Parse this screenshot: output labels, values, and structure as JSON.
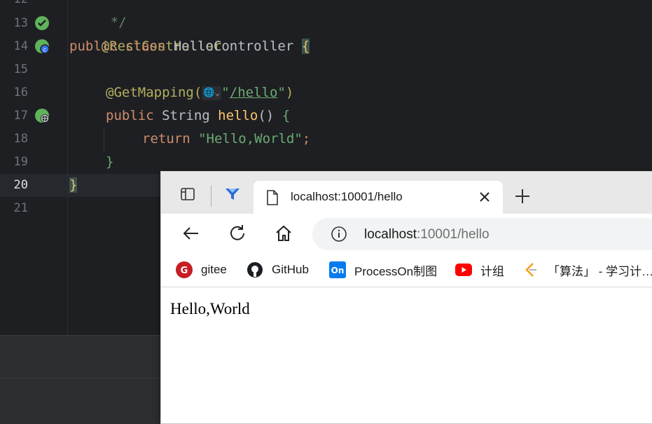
{
  "editor": {
    "line_numbers": [
      "12",
      "13",
      "14",
      "15",
      "16",
      "17",
      "18",
      "19",
      "20",
      "21"
    ],
    "lines": {
      "l12": "*/",
      "l13_annotation": "@RestController",
      "l14_kw": "public class ",
      "l14_class": "HelloController ",
      "l14_brace": "{",
      "l16_annotation": "@GetMapping(",
      "l16_quote_open": "\"",
      "l16_path": "/hello",
      "l16_quote_close": "\"",
      "l16_close": ")",
      "l17_kw": "public ",
      "l17_type": "String ",
      "l17_method": "hello",
      "l17_parens": "() ",
      "l17_brace": "{",
      "l18_kw": "return ",
      "l18_string": "\"Hello,World\"",
      "l18_semi": ";",
      "l19_brace": "}",
      "l20_brace": "}"
    },
    "inlay_hint": "🌐⌄"
  },
  "browser": {
    "tab": {
      "title": "localhost:10001/hello"
    },
    "address": {
      "host": "localhost",
      "rest": ":10001/hello"
    },
    "bookmarks": [
      {
        "label": "gitee",
        "icon": "gitee-icon"
      },
      {
        "label": "GitHub",
        "icon": "github-icon"
      },
      {
        "label": "ProcessOn制图",
        "icon": "processon-icon"
      },
      {
        "label": "计组",
        "icon": "youtube-icon"
      },
      {
        "label": "「算法」 - 学习计…",
        "icon": "leetcode-icon"
      }
    ],
    "page_text": "Hello,World"
  },
  "colors": {
    "ide_bg": "#1e1f22",
    "annotation": "#b3ae60",
    "keyword": "#cf8e6d",
    "string": "#6aab73",
    "browser_tabstrip": "#e8e8e8"
  }
}
